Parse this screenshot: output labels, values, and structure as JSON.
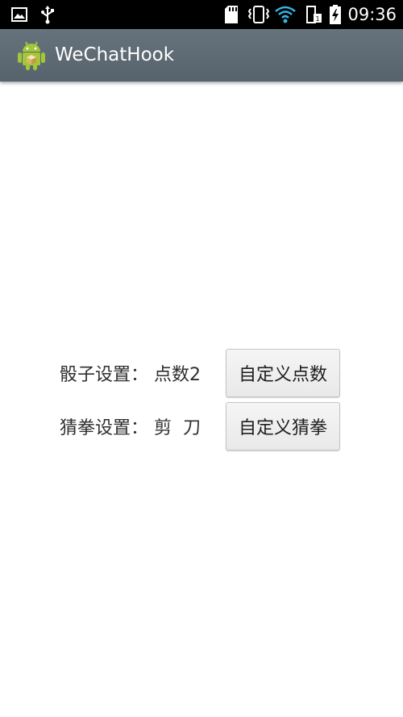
{
  "status_bar": {
    "time": "09:36",
    "icons": [
      "image-icon",
      "usb-icon",
      "sd-card-icon",
      "vibrate-icon",
      "wifi-icon",
      "sim-icon",
      "battery-icon"
    ]
  },
  "action_bar": {
    "title": "WeChatHook",
    "icon": "android-icon"
  },
  "settings": {
    "dice": {
      "label": "骰子设置： 点数2",
      "button_label": "自定义点数"
    },
    "rps": {
      "label": "猜拳设置： 剪  刀",
      "button_label": "自定义猜拳"
    }
  },
  "colors": {
    "status_bar_bg": "#000000",
    "action_bar_bg": "#5f6b74",
    "wifi_accent": "#33b5e5",
    "android_green": "#a4c639"
  }
}
